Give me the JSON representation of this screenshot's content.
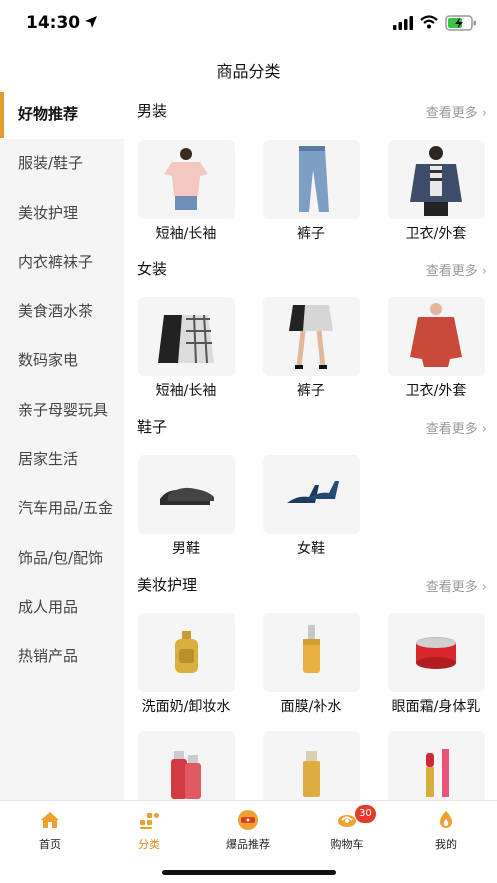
{
  "status_bar": {
    "time": "14:30"
  },
  "nav": {
    "title": "商品分类"
  },
  "sidebar": {
    "items": [
      {
        "label": "好物推荐",
        "active": true
      },
      {
        "label": "服装/鞋子",
        "active": false
      },
      {
        "label": "美妆护理",
        "active": false
      },
      {
        "label": "内衣裤袜子",
        "active": false
      },
      {
        "label": "美食酒水茶",
        "active": false
      },
      {
        "label": "数码家电",
        "active": false
      },
      {
        "label": "亲子母婴玩具",
        "active": false
      },
      {
        "label": "居家生活",
        "active": false
      },
      {
        "label": "汽车用品/五金",
        "active": false
      },
      {
        "label": "饰品/包/配饰",
        "active": false
      },
      {
        "label": "成人用品",
        "active": false
      },
      {
        "label": "热销产品",
        "active": false
      }
    ]
  },
  "sections": [
    {
      "title": "男装",
      "more": "查看更多",
      "products": [
        "短袖/长袖",
        "裤子",
        "卫衣/外套"
      ]
    },
    {
      "title": "女装",
      "more": "查看更多",
      "products": [
        "短袖/长袖",
        "裤子",
        "卫衣/外套"
      ]
    },
    {
      "title": "鞋子",
      "more": "查看更多",
      "products": [
        "男鞋",
        "女鞋"
      ]
    },
    {
      "title": "美妆护理",
      "more": "查看更多",
      "products": [
        "洗面奶/卸妆水",
        "面膜/补水",
        "眼面霜/身体乳"
      ]
    }
  ],
  "tabbar": {
    "items": [
      {
        "label": "首页",
        "icon": "home-icon",
        "active": false
      },
      {
        "label": "分类",
        "icon": "category-icon",
        "active": true
      },
      {
        "label": "爆品推荐",
        "icon": "hot-deals-icon",
        "active": false
      },
      {
        "label": "购物车",
        "icon": "cart-icon",
        "active": false,
        "badge": "30"
      },
      {
        "label": "我的",
        "icon": "profile-icon",
        "active": false
      }
    ]
  },
  "colors": {
    "accent": "#e0a030",
    "badge": "#e43c2a",
    "sidebar_bg": "#f5f5f5"
  }
}
